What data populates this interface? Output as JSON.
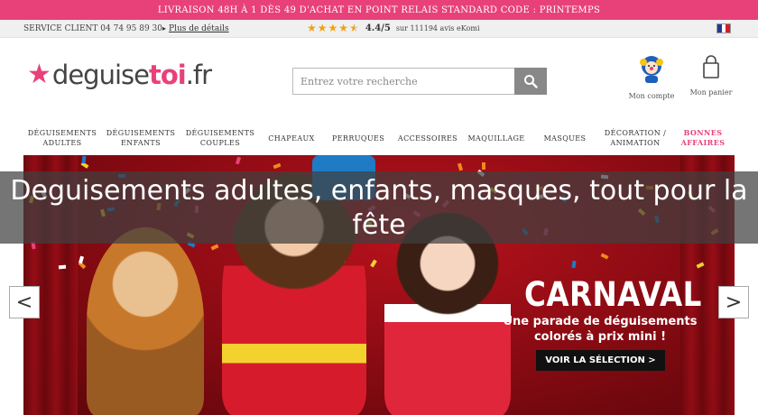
{
  "promo": {
    "text": "LIVRAISON 48H À 1  DÈS 49  D'ACHAT EN POINT RELAIS STANDARD CODE : PRINTEMPS"
  },
  "infobar": {
    "service": "SERVICE CLIENT 04 74 95 89 30",
    "details_link": "Plus de détails",
    "rating": {
      "stars": 4.5,
      "score": "4.4/5",
      "count": "sur 111194 avis eKomi",
      "star_color": "#f4a10e"
    },
    "flag_colors": [
      "#1f3a93",
      "#ffffff",
      "#d0202a"
    ]
  },
  "header": {
    "logo": {
      "part1": "deguise",
      "part2": "toi",
      "part3": ".fr",
      "accent": "#e8417a"
    },
    "search": {
      "placeholder": "Entrez votre recherche",
      "icon": "search-icon"
    },
    "account": {
      "label": "Mon compte",
      "icon": "clown-avatar-icon"
    },
    "cart": {
      "label": "Mon panier",
      "icon": "shopping-bag-icon"
    }
  },
  "nav": {
    "items": [
      {
        "label": "DÉGUISEMENTS\nADULTES",
        "slug": "adultes",
        "hot": false
      },
      {
        "label": "DÉGUISEMENTS\nENFANTS",
        "slug": "enfants",
        "hot": false
      },
      {
        "label": "DÉGUISEMENTS\nCOUPLES",
        "slug": "couples",
        "hot": false
      },
      {
        "label": "CHAPEAUX",
        "slug": "chapeaux",
        "hot": false
      },
      {
        "label": "PERRUQUES",
        "slug": "perruques",
        "hot": false
      },
      {
        "label": "ACCESSOIRES",
        "slug": "accessoires",
        "hot": false
      },
      {
        "label": "MAQUILLAGE",
        "slug": "maquillage",
        "hot": false
      },
      {
        "label": "MASQUES",
        "slug": "masques",
        "hot": false
      },
      {
        "label": "DÉCORATION /\nANIMATION",
        "slug": "decoration",
        "hot": false
      },
      {
        "label": "BONNES\nAFFAIRES",
        "slug": "bonnes-affaires",
        "hot": true
      }
    ]
  },
  "banner": {
    "headline": "CARNAVAL",
    "sub_line1": "Une parade de déguisements",
    "sub_line2": "colorés à prix mini !",
    "cta": "VOIR LA SÉLECTION >",
    "prev": "<",
    "next": ">"
  },
  "overlay": {
    "caption": "Deguisements adultes, enfants, masques, tout pour la fête"
  },
  "colors": {
    "brand_pink": "#e8417a",
    "banner_red": "#b8121c",
    "search_button": "#888888"
  }
}
